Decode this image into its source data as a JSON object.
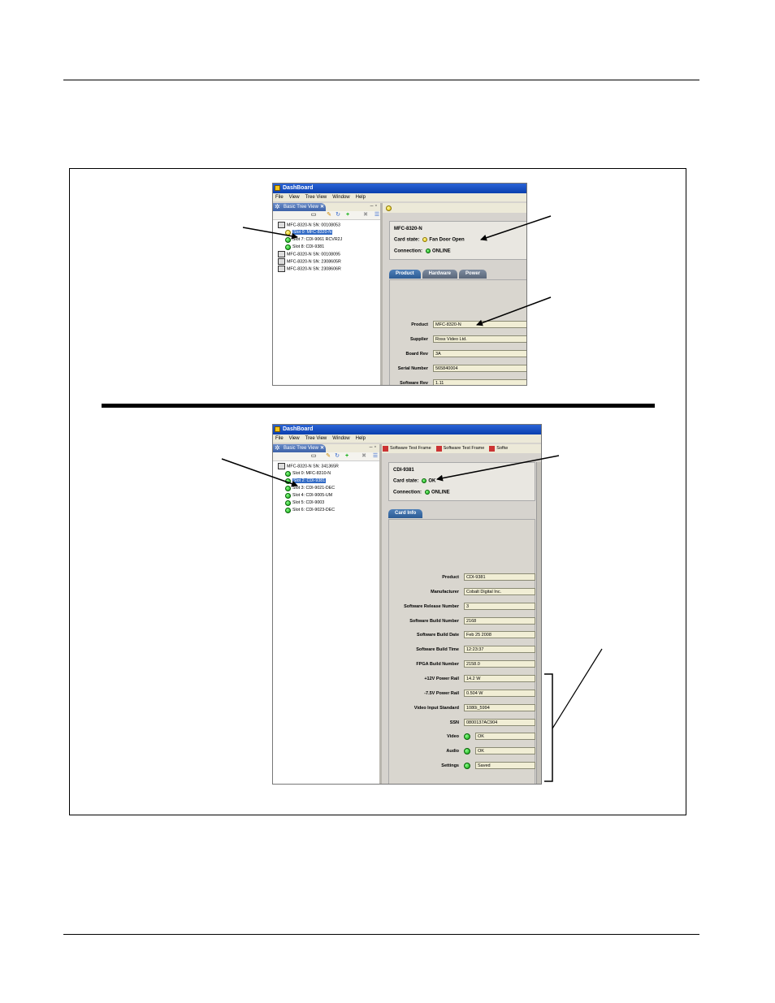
{
  "screenshot_top": {
    "window_title": "DashBoard",
    "menu": [
      "File",
      "View",
      "Tree View",
      "Window",
      "Help"
    ],
    "view_tab": "Basic Tree View",
    "tree": [
      {
        "label": "MFC-8320-N SN: 00108053",
        "level": 1
      },
      {
        "label": "Slot 0: MFC-8320-N",
        "level": 2,
        "status": "yellow",
        "selected": true
      },
      {
        "label": "Slot 7: CDI-9061 RCVR2J",
        "level": 2,
        "status": "green"
      },
      {
        "label": "Slot 8: CDI-9381",
        "level": 2,
        "status": "green"
      },
      {
        "label": "MFC-8320-N SN: 00108095",
        "level": 1
      },
      {
        "label": "MFC-8320-N SN: 2308605R",
        "level": 1
      },
      {
        "label": "MFC-8320-N SN: 2308606R",
        "level": 1
      }
    ],
    "card_name": "MFC-8320-N",
    "card_state_label": "Card state:",
    "card_state_value": "Fan Door Open",
    "connection_label": "Connection:",
    "connection_value": "ONLINE",
    "tabs": [
      "Product",
      "Hardware",
      "Power"
    ],
    "fields": [
      {
        "label": "Product",
        "value": "MFC-8320-N"
      },
      {
        "label": "Supplier",
        "value": "Ross Video Ltd."
      },
      {
        "label": "Board Rev",
        "value": "3A"
      },
      {
        "label": "Serial Number",
        "value": "565840004"
      },
      {
        "label": "Software Rev",
        "value": "1.11"
      }
    ]
  },
  "screenshot_bottom": {
    "window_title": "DashBoard",
    "menu": [
      "File",
      "View",
      "Tree View",
      "Window",
      "Help"
    ],
    "view_tab": "Basic Tree View",
    "editor_tabs": [
      "Software Test Frame",
      "Software Test Frame",
      "Softw"
    ],
    "tree": [
      {
        "label": "MFC-8320-N SN: 341365R",
        "level": 1
      },
      {
        "label": "Slot 0: MFC-8310-N",
        "level": 2,
        "status": "green"
      },
      {
        "label": "Slot 2: CDI-9381",
        "level": 2,
        "status": "green",
        "selected": true
      },
      {
        "label": "Slot 3: CDI-9021-DEC",
        "level": 2,
        "status": "green"
      },
      {
        "label": "Slot 4: CDI-9005-UM",
        "level": 2,
        "status": "green"
      },
      {
        "label": "Slot 5: CDI-9003",
        "level": 2,
        "status": "green"
      },
      {
        "label": "Slot 6: CDI-9023-DEC",
        "level": 2,
        "status": "green"
      }
    ],
    "card_name": "CDI-9381",
    "card_state_label": "Card state:",
    "card_state_value": "OK",
    "connection_label": "Connection:",
    "connection_value": "ONLINE",
    "tabs": [
      "Card Info"
    ],
    "fields": [
      {
        "label": "Product",
        "value": "CDI-9381"
      },
      {
        "label": "Manufacturer",
        "value": "Cobalt Digital Inc."
      },
      {
        "label": "Software Release Number",
        "value": "3"
      },
      {
        "label": "Software Build Number",
        "value": "2168"
      },
      {
        "label": "Software Build Date",
        "value": "Feb 25 2008"
      },
      {
        "label": "Software Build Time",
        "value": "12:23:37"
      },
      {
        "label": "FPGA Build Number",
        "value": "2158.0"
      },
      {
        "label": "+12V Power Rail",
        "value": "14.2 W"
      },
      {
        "label": "-7.5V Power Rail",
        "value": "0.504 W"
      },
      {
        "label": "Video Input Standard",
        "value": "1080i_5994"
      },
      {
        "label": "SSN",
        "value": "0800137AC904"
      },
      {
        "label": "Video",
        "value": "OK",
        "indicator": "green"
      },
      {
        "label": "Audio",
        "value": "OK",
        "indicator": "green"
      },
      {
        "label": "Settings",
        "value": "Saved",
        "indicator": "green"
      }
    ]
  },
  "colors": {
    "status_ok": "#0aa00a",
    "status_warning": "#e6c400",
    "title_bar": "#0a3fae",
    "selection": "#316ac5"
  }
}
